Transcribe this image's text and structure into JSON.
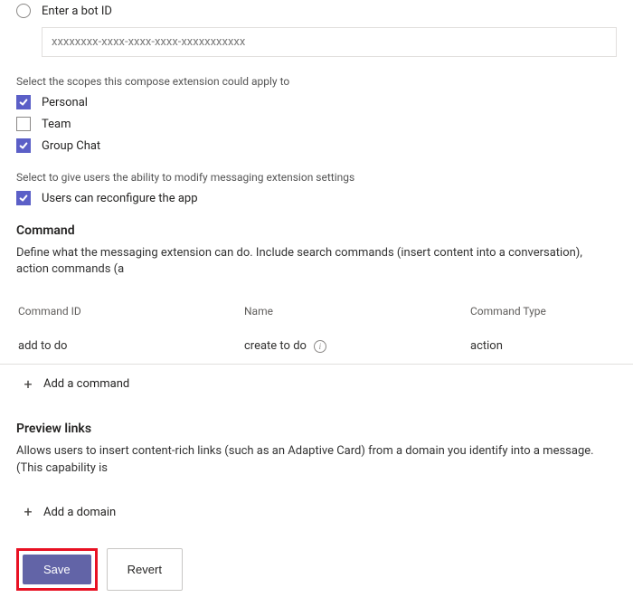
{
  "botId": {
    "radioLabel": "Enter a bot ID",
    "value": "xxxxxxxx-xxxx-xxxx-xxxx-xxxxxxxxxxx"
  },
  "scopes": {
    "instruction": "Select the scopes this compose extension could apply to",
    "items": [
      {
        "label": "Personal",
        "checked": true
      },
      {
        "label": "Team",
        "checked": false
      },
      {
        "label": "Group Chat",
        "checked": true
      }
    ]
  },
  "reconfigure": {
    "instruction": "Select to give users the ability to modify messaging extension settings",
    "label": "Users can reconfigure the app",
    "checked": true
  },
  "command": {
    "heading": "Command",
    "desc": "Define what the messaging extension can do. Include search commands (insert content into a conversation), action commands (a",
    "columns": {
      "id": "Command ID",
      "name": "Name",
      "type": "Command Type"
    },
    "rows": [
      {
        "id": "add to do",
        "name": "create to do",
        "type": "action"
      }
    ],
    "add": "Add a command"
  },
  "preview": {
    "heading": "Preview links",
    "desc": "Allows users to insert content-rich links (such as an Adaptive Card) from a domain you identify into a message. (This capability is",
    "add": "Add a domain"
  },
  "footer": {
    "save": "Save",
    "revert": "Revert"
  }
}
